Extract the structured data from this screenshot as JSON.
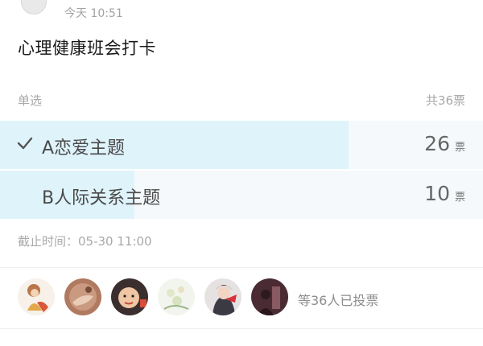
{
  "header": {
    "time": "今天 10:51"
  },
  "post": {
    "title": "心理健康班会打卡"
  },
  "vote": {
    "type_label": "单选",
    "total_label": "共36票",
    "total": 36,
    "options": [
      {
        "label": "A恋爱主题",
        "count": "26",
        "unit": "票",
        "votes": 26,
        "selected": true
      },
      {
        "label": "B人际关系主题",
        "count": "10",
        "unit": "票",
        "votes": 10,
        "selected": false
      }
    ],
    "deadline": "截止时间：05-30 11:00",
    "voters_text": "等36人已投票",
    "voters": [
      {
        "icon": "avatar-cartoon"
      },
      {
        "icon": "avatar-hand"
      },
      {
        "icon": "avatar-child"
      },
      {
        "icon": "avatar-flowers"
      },
      {
        "icon": "avatar-girl-red"
      },
      {
        "icon": "avatar-dark"
      }
    ]
  },
  "colors": {
    "selected_fill": "#dff3fb",
    "row_bg": "#f5f9fb",
    "muted_text": "#a8a8a8"
  }
}
